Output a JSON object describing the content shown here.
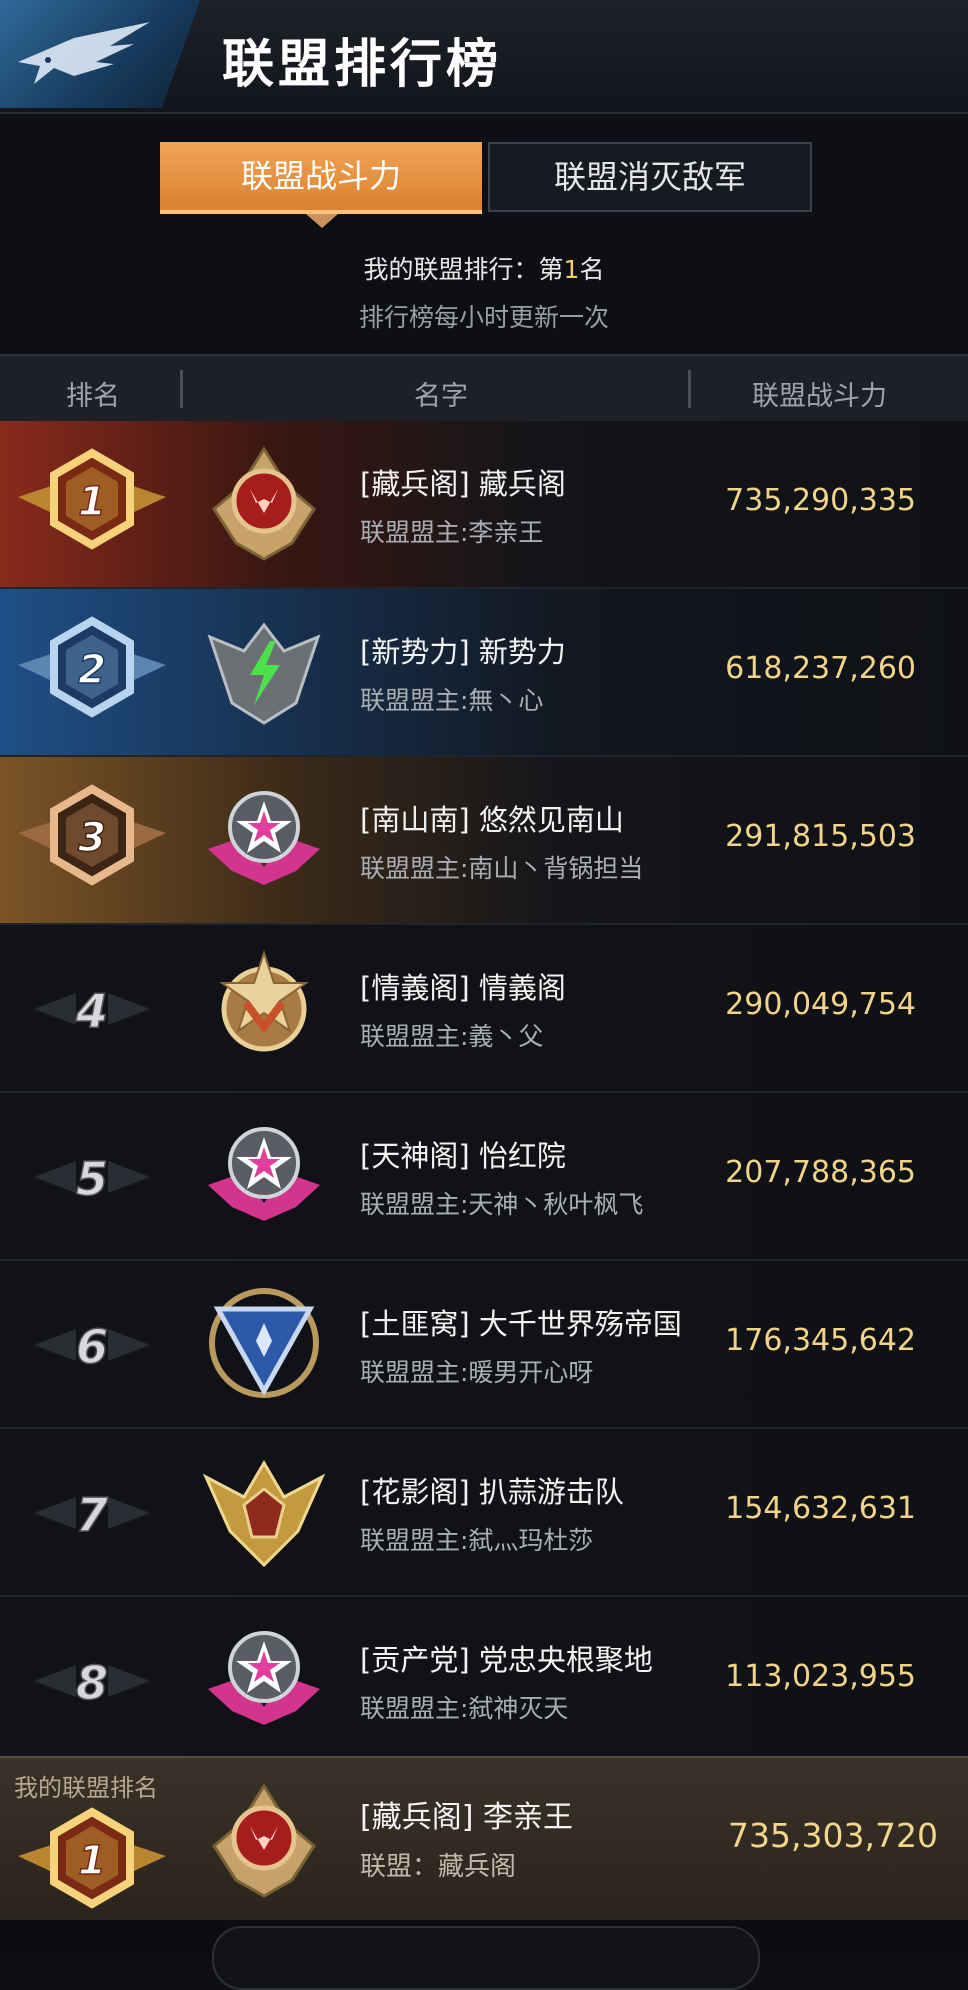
{
  "header": {
    "title": "联盟排行榜",
    "logo_icon": "eagle-wing-icon"
  },
  "tabs": [
    {
      "label": "联盟战斗力",
      "active": true
    },
    {
      "label": "联盟消灭敌军",
      "active": false
    }
  ],
  "info": {
    "my_rank_prefix": "我的联盟排行：第",
    "my_rank_num": "1",
    "my_rank_suffix": "名",
    "update_note": "排行榜每小时更新一次"
  },
  "columns": {
    "rank": "排名",
    "name": "名字",
    "power": "联盟战斗力"
  },
  "rows": [
    {
      "rank": "1",
      "name": "[藏兵阁] 藏兵阁",
      "leader": "联盟盟主:李亲王",
      "power": "735,290,335",
      "emblem": "fox-shield-emblem-icon",
      "color": "#b13a2a"
    },
    {
      "rank": "2",
      "name": "[新势力] 新势力",
      "leader": "联盟盟主:無丶心",
      "power": "618,237,260",
      "emblem": "lightning-wings-emblem-icon",
      "color": "#2f6aa8"
    },
    {
      "rank": "3",
      "name": "[南山南] 悠然见南山",
      "leader": "联盟盟主:南山丶背锅担当",
      "power": "291,815,503",
      "emblem": "pink-star-emblem-icon",
      "color": "#a0703b"
    },
    {
      "rank": "4",
      "name": "[情義阁] 情義阁",
      "leader": "联盟盟主:義丶父",
      "power": "290,049,754",
      "emblem": "gold-star-emblem-icon",
      "color": "#555"
    },
    {
      "rank": "5",
      "name": "[天神阁] 怡红院",
      "leader": "联盟盟主:天神丶秋叶枫飞",
      "power": "207,788,365",
      "emblem": "pink-star-emblem-icon",
      "color": "#555"
    },
    {
      "rank": "6",
      "name": "[土匪窝] 大千世界殇帝国",
      "leader": "联盟盟主:暖男开心呀",
      "power": "176,345,642",
      "emblem": "blue-laurel-emblem-icon",
      "color": "#555"
    },
    {
      "rank": "7",
      "name": "[花影阁] 扒蒜游击队",
      "leader": "联盟盟主:弑灬玛杜莎",
      "power": "154,632,631",
      "emblem": "gold-wings-emblem-icon",
      "color": "#555"
    },
    {
      "rank": "8",
      "name": "[贡产党] 党忠央根聚地",
      "leader": "联盟盟主:弑神灭天",
      "power": "113,023,955",
      "emblem": "pink-star-emblem-icon",
      "color": "#555"
    }
  ],
  "my_alliance": {
    "label": "我的联盟排名",
    "rank": "1",
    "name": "[藏兵阁] 李亲王",
    "leader": "联盟：藏兵阁",
    "power": "735,303,720",
    "emblem": "fox-shield-emblem-icon"
  }
}
